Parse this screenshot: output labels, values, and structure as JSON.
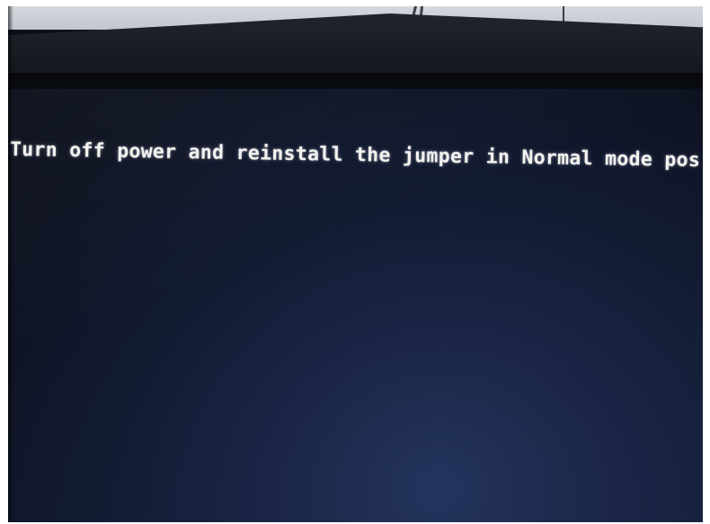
{
  "screen": {
    "message": "Turn off power and reinstall the jumper in Normal mode pos:",
    "text_color": "#f2f2ee",
    "background_color": "#121a30"
  }
}
